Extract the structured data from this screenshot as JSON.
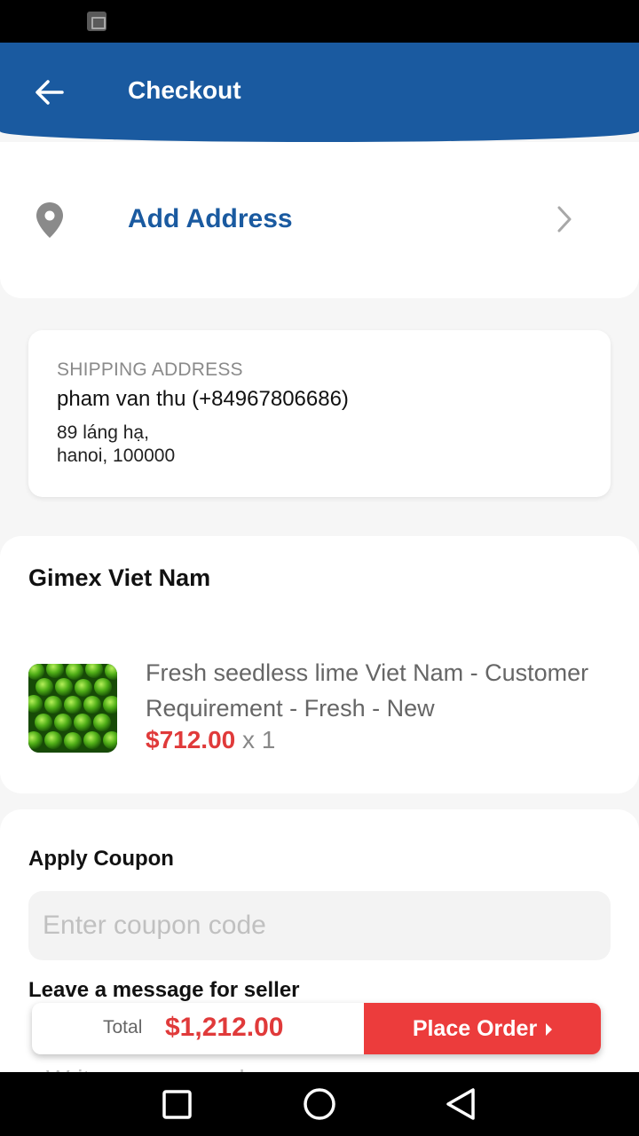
{
  "header": {
    "title": "Checkout"
  },
  "address_row": {
    "label": "Add Address"
  },
  "shipping": {
    "heading": "SHIPPING ADDRESS",
    "name_phone": "pham van thu (+84967806686)",
    "line1": "89 láng hạ,",
    "line2": "hanoi, 100000"
  },
  "order": {
    "seller": "Gimex Viet Nam",
    "product": {
      "title": "Fresh seedless lime Viet Nam - Customer Requirement - Fresh - New",
      "price": "$712.00",
      "quantity": "x 1"
    }
  },
  "coupon": {
    "heading": "Apply Coupon",
    "placeholder": "Enter coupon code"
  },
  "message": {
    "heading": "Leave a message for seller",
    "placeholder": "Write a message here"
  },
  "footer": {
    "total_label": "Total",
    "total_value": "$1,212.00",
    "place_order_label": "Place Order"
  },
  "colors": {
    "primary": "#1a5aa0",
    "accent_red": "#ec3c3c",
    "price_red": "#e03a3a"
  },
  "icons": {
    "back": "arrow-left-icon",
    "location": "map-pin-icon",
    "chevron": "chevron-right-icon",
    "place_order_caret": "caret-right-icon"
  }
}
